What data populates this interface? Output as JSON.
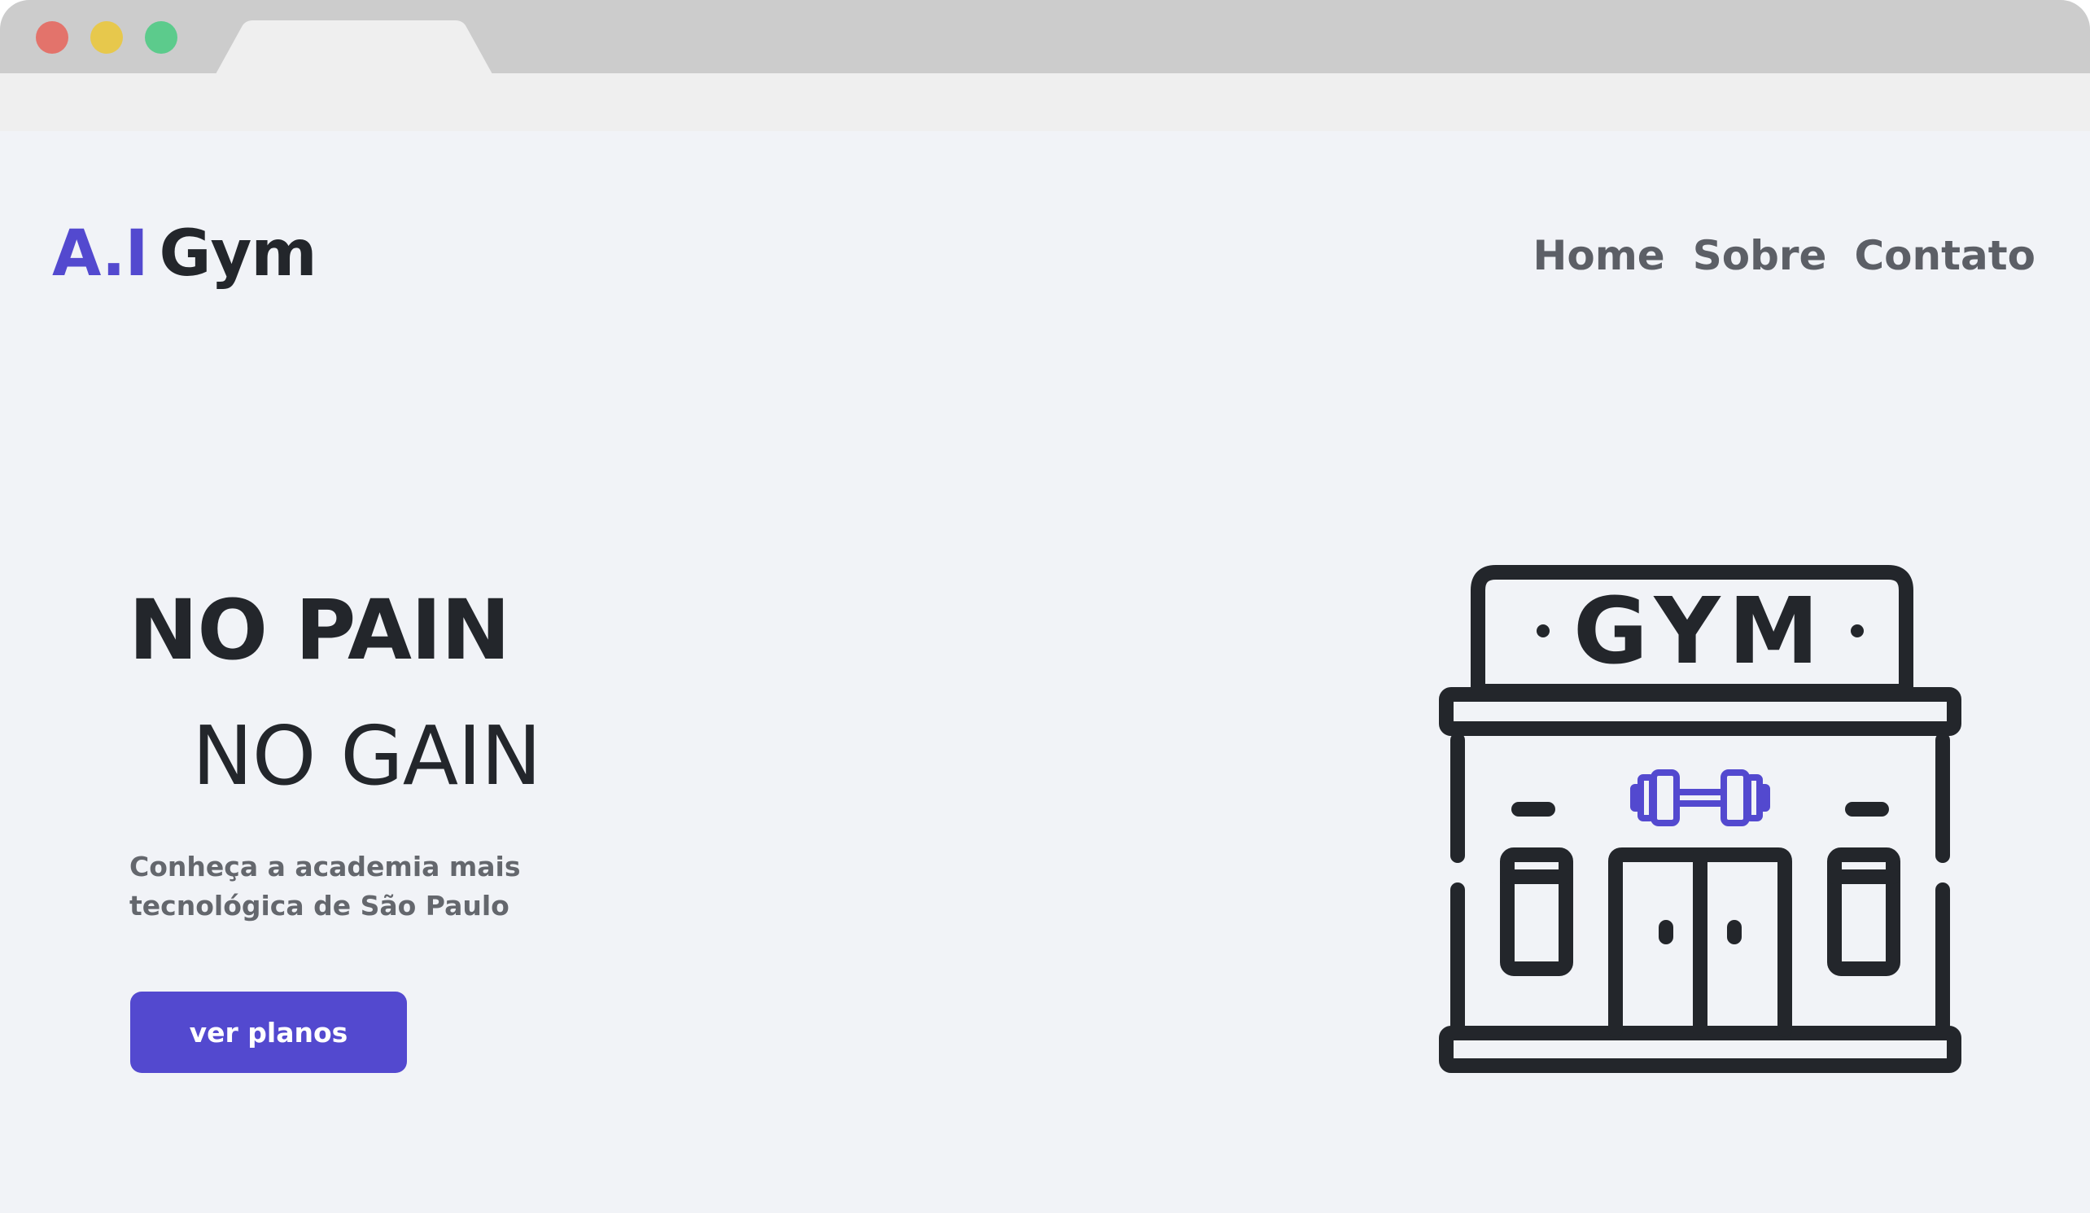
{
  "browser": {
    "window_controls": [
      "close",
      "minimize",
      "maximize"
    ],
    "colors": {
      "close": "#e3736b",
      "minimize": "#e7c84c",
      "maximize": "#5ccb8c"
    }
  },
  "header": {
    "logo_accent": "A.I",
    "logo_rest": "Gym",
    "nav": [
      {
        "label": "Home"
      },
      {
        "label": "Sobre"
      },
      {
        "label": "Contato"
      }
    ]
  },
  "hero": {
    "headline_line1": "NO PAIN",
    "headline_line2": "NO GAIN",
    "subtitle": "Conheça a academia mais tecnológica de São Paulo",
    "cta_label": "ver planos",
    "illustration_sign": "GYM",
    "illustration_icons": [
      "gym-building-icon",
      "dumbbell-icon"
    ]
  },
  "colors": {
    "accent": "#5349cf",
    "text_dark": "#23262b",
    "text_muted": "#5c5f66",
    "page_bg": "#f1f3f7"
  }
}
